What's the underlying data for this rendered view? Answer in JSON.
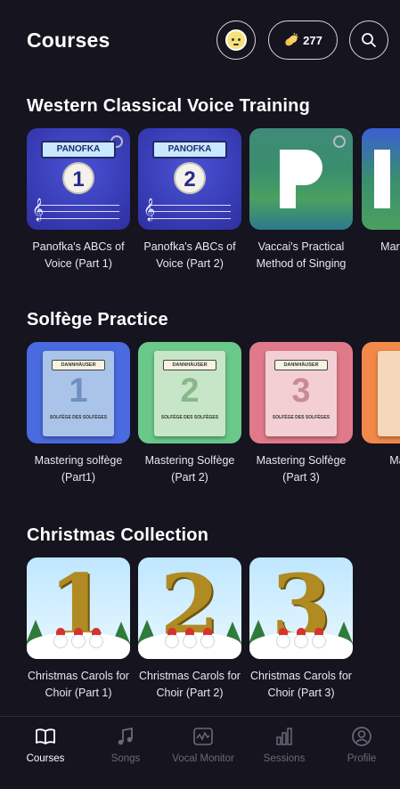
{
  "header": {
    "title": "Courses",
    "coin_count": "277",
    "icons": {
      "avatar": "avatar-face",
      "coins": "clapping-hands-icon",
      "search": "search-icon"
    }
  },
  "sections": [
    {
      "title": "Western Classical Voice Training",
      "cards": [
        {
          "title": "Panofka's ABCs of Voice (Part 1)",
          "banner": "PANOFKA",
          "number": "1"
        },
        {
          "title": "Panofka's ABCs of Voice (Part 2)",
          "banner": "PANOFKA",
          "number": "2"
        },
        {
          "title": "Vaccai's Practical Method of Singing"
        },
        {
          "title": "Marc Elemen"
        }
      ]
    },
    {
      "title": "Solfège Practice",
      "cards": [
        {
          "title": "Mastering solfège (Part1)",
          "banner": "DANNHÄUSER",
          "number": "1",
          "subtitle": "SOLFÈGE DES SOLFÈGES"
        },
        {
          "title": "Mastering Solfège (Part 2)",
          "banner": "DANNHÄUSER",
          "number": "2",
          "subtitle": "SOLFÈGE DES SOLFÈGES"
        },
        {
          "title": "Mastering Solfège (Part 3)",
          "banner": "DANNHÄUSER",
          "number": "3",
          "subtitle": "SOLFÈGE DES SOLFÈGES"
        },
        {
          "title": "Master (F"
        }
      ]
    },
    {
      "title": "Christmas Collection",
      "cards": [
        {
          "title": "Christmas Carols for Choir (Part 1)",
          "number": "1"
        },
        {
          "title": "Christmas Carols for Choir (Part 2)",
          "number": "2"
        },
        {
          "title": "Christmas Carols for Choir (Part 3)",
          "number": "3"
        }
      ]
    }
  ],
  "tabs": [
    {
      "label": "Courses",
      "icon": "book-icon",
      "active": true
    },
    {
      "label": "Songs",
      "icon": "music-note-icon",
      "active": false
    },
    {
      "label": "Vocal Monitor",
      "icon": "waveform-icon",
      "active": false
    },
    {
      "label": "Sessions",
      "icon": "bar-chart-icon",
      "active": false
    },
    {
      "label": "Profile",
      "icon": "profile-icon",
      "active": false
    }
  ],
  "colors": {
    "background": "#15141f",
    "panofka": "#3a3fc4",
    "solfege_blue": "#4a6ae0",
    "solfege_green": "#6ac88a",
    "solfege_pink": "#e07a8a",
    "solfege_orange": "#f2894a",
    "tab_inactive": "#6b6a76"
  }
}
